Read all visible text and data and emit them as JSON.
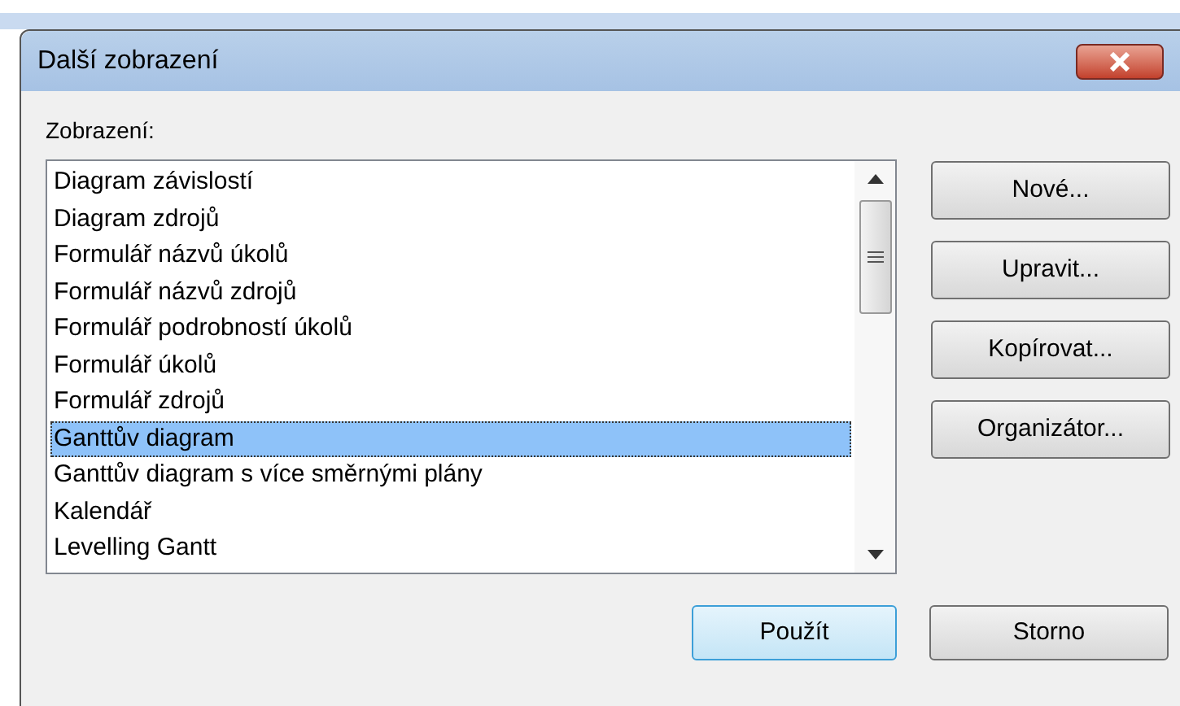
{
  "window": {
    "title": "Další zobrazení"
  },
  "list": {
    "label": "Zobrazení:",
    "items": [
      {
        "label": "Diagram závislostí",
        "selected": false
      },
      {
        "label": "Diagram zdrojů",
        "selected": false
      },
      {
        "label": "Formulář názvů úkolů",
        "selected": false
      },
      {
        "label": "Formulář názvů zdrojů",
        "selected": false
      },
      {
        "label": "Formulář podrobností úkolů",
        "selected": false
      },
      {
        "label": "Formulář úkolů",
        "selected": false
      },
      {
        "label": "Formulář zdrojů",
        "selected": false
      },
      {
        "label": "Ganttův diagram",
        "selected": true
      },
      {
        "label": "Ganttův diagram s více směrnými plány",
        "selected": false
      },
      {
        "label": "Kalendář",
        "selected": false
      },
      {
        "label": "Levelling Gantt",
        "selected": false
      }
    ]
  },
  "side_buttons": [
    "Nové...",
    "Upravit...",
    "Kopírovat...",
    "Organizátor..."
  ],
  "buttons": [
    {
      "label": "Použít",
      "default": true
    },
    {
      "label": "Storno",
      "default": false
    }
  ]
}
